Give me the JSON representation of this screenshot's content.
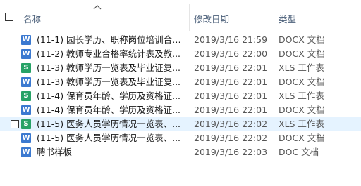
{
  "header": {
    "name_label": "名称",
    "date_label": "修改日期",
    "type_label": "类型"
  },
  "files": [
    {
      "icon": "word-doc-icon",
      "glyph": "W",
      "name": "(11-1) 园长学历、职称岗位培训合格...",
      "date": "2019/3/16 21:59",
      "type": "DOCX 文档",
      "hover": false
    },
    {
      "icon": "word-doc-icon",
      "glyph": "W",
      "name": "(11-2) 教师专业合格率统计表及教...",
      "date": "2019/3/16 22:00",
      "type": "DOCX 文档",
      "hover": false
    },
    {
      "icon": "spreadsheet-icon",
      "glyph": "S",
      "name": "(11-3) 教师学历一览表及毕业证复...",
      "date": "2019/3/16 22:01",
      "type": "XLS 工作表",
      "hover": false
    },
    {
      "icon": "word-doc-icon",
      "glyph": "W",
      "name": "(11-3) 教师学历一览表及毕业证复...",
      "date": "2019/3/16 22:01",
      "type": "DOCX 文档",
      "hover": false
    },
    {
      "icon": "spreadsheet-icon",
      "glyph": "S",
      "name": "(11-4) 保育员年龄、学历及资格证...",
      "date": "2019/3/16 22:01",
      "type": "XLS 工作表",
      "hover": false
    },
    {
      "icon": "word-doc-icon",
      "glyph": "W",
      "name": "(11-4) 保育员年龄、学历及资格证...",
      "date": "2019/3/16 22:01",
      "type": "DOCX 文档",
      "hover": false
    },
    {
      "icon": "spreadsheet-icon",
      "glyph": "S",
      "name": "(11-5) 医务人员学历情况一览表、...",
      "date": "2019/3/16 22:02",
      "type": "XLS 工作表",
      "hover": true
    },
    {
      "icon": "word-doc-icon",
      "glyph": "W",
      "name": "(11-5) 医务人员学历情况一览表、...",
      "date": "2019/3/16 22:02",
      "type": "DOCX 文档",
      "hover": false
    },
    {
      "icon": "word-doc-icon",
      "glyph": "W",
      "name": "聘书样板",
      "date": "2019/3/16 22:03",
      "type": "DOC 文档",
      "hover": false
    }
  ]
}
